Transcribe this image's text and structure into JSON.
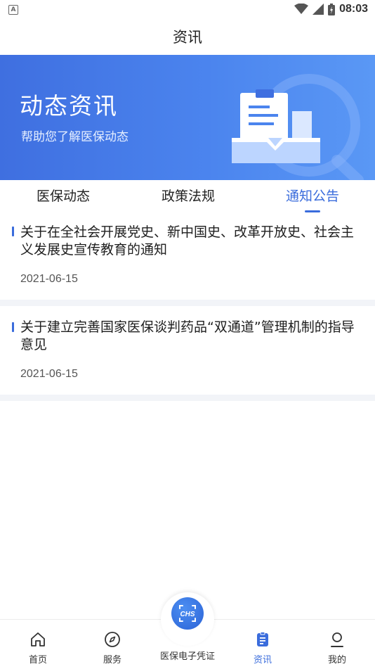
{
  "status_bar": {
    "indicator": "A",
    "time": "08:03"
  },
  "header": {
    "title": "资讯"
  },
  "banner": {
    "title": "动态资讯",
    "subtitle": "帮助您了解医保动态"
  },
  "tabs": [
    {
      "label": "医保动态",
      "active": false
    },
    {
      "label": "政策法规",
      "active": false
    },
    {
      "label": "通知公告",
      "active": true
    }
  ],
  "news": [
    {
      "title": "关于在全社会开展党史、新中国史、改革开放史、社会主义发展史宣传教育的通知",
      "date": "2021-06-15"
    },
    {
      "title": "关于建立完善国家医保谈判药品“双通道”管理机制的指导意见",
      "date": "2021-06-15"
    }
  ],
  "bottom_nav": [
    {
      "label": "首页",
      "icon": "home-icon",
      "active": false
    },
    {
      "label": "服务",
      "icon": "compass-icon",
      "active": false
    },
    {
      "label": "医保电子凭证",
      "icon": "chs-icon",
      "active": false
    },
    {
      "label": "资讯",
      "icon": "clipboard-icon",
      "active": true
    },
    {
      "label": "我的",
      "icon": "user-icon",
      "active": false
    }
  ],
  "fab": {
    "text": "CHS"
  },
  "colors": {
    "accent": "#3a6cdc",
    "banner": "#4b84ee"
  }
}
